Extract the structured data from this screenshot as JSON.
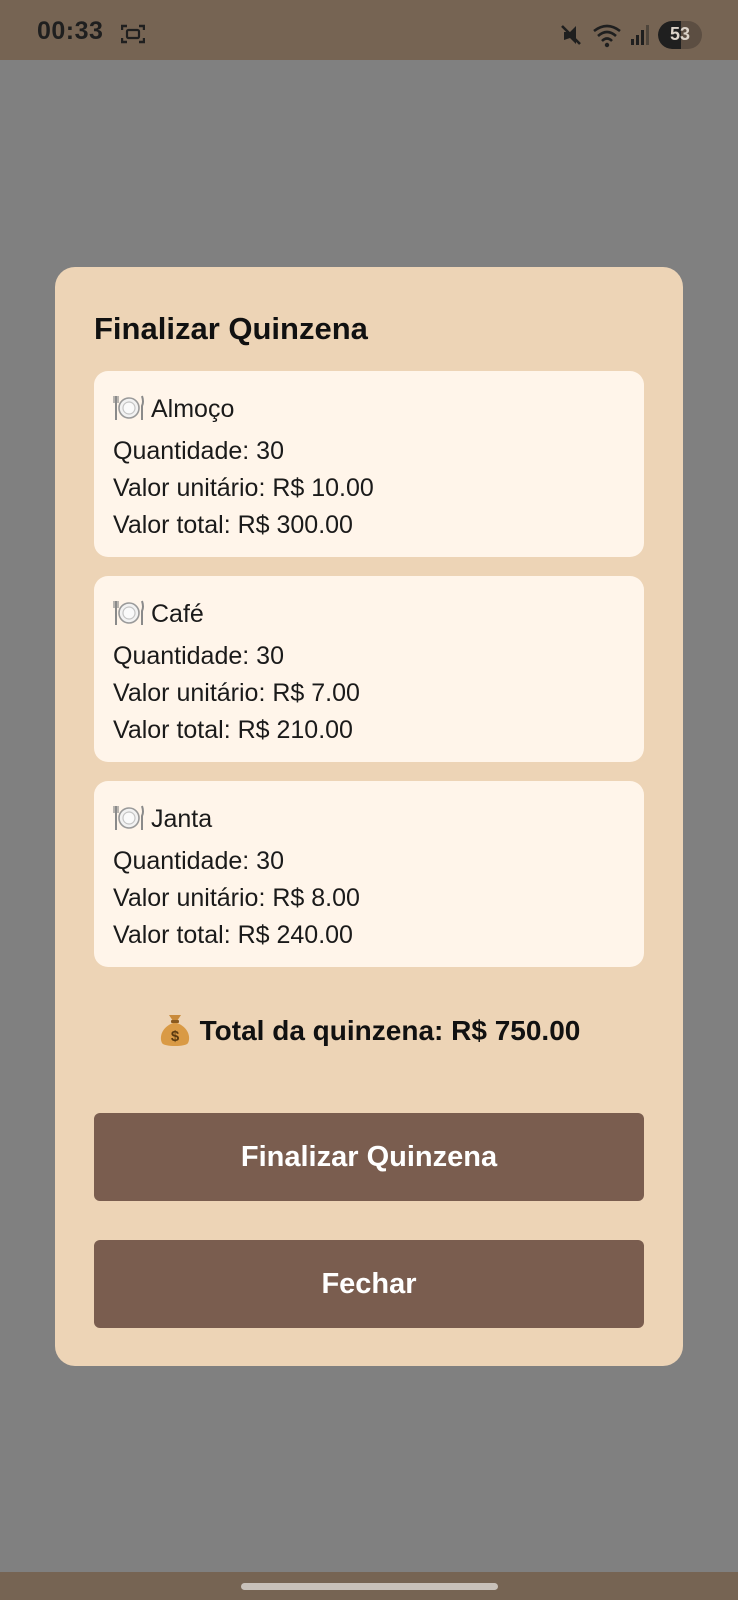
{
  "status_bar": {
    "time": "00:33",
    "battery": "53",
    "battery_level": 0.53,
    "icons": [
      "screen-capture-icon",
      "mute-icon",
      "wifi-icon",
      "signal-icon",
      "battery-icon"
    ]
  },
  "modal": {
    "title": "Finalizar Quinzena",
    "items": [
      {
        "icon": "plate-icon",
        "name": "Almoço",
        "quantity": "Quantidade: 30",
        "unit_price": "Valor unitário: R$ 10.00",
        "total": "Valor total: R$ 300.00"
      },
      {
        "icon": "plate-icon",
        "name": "Café",
        "quantity": "Quantidade: 30",
        "unit_price": "Valor unitário: R$ 7.00",
        "total": "Valor total: R$ 210.00"
      },
      {
        "icon": "plate-icon",
        "name": "Janta",
        "quantity": "Quantidade: 30",
        "unit_price": "Valor unitário: R$ 8.00",
        "total": "Valor total: R$ 240.00"
      }
    ],
    "total_icon": "money-bag-icon",
    "total_text": "Total da quinzena: R$ 750.00",
    "finalize_button": "Finalizar Quinzena",
    "close_button": "Fechar"
  },
  "colors": {
    "status_bar": "#766453",
    "overlay": "#808080",
    "modal_bg": "#edd4b6",
    "card_bg": "#fff5ea",
    "button_bg": "#7a5d4f",
    "button_text": "#ffffff"
  }
}
